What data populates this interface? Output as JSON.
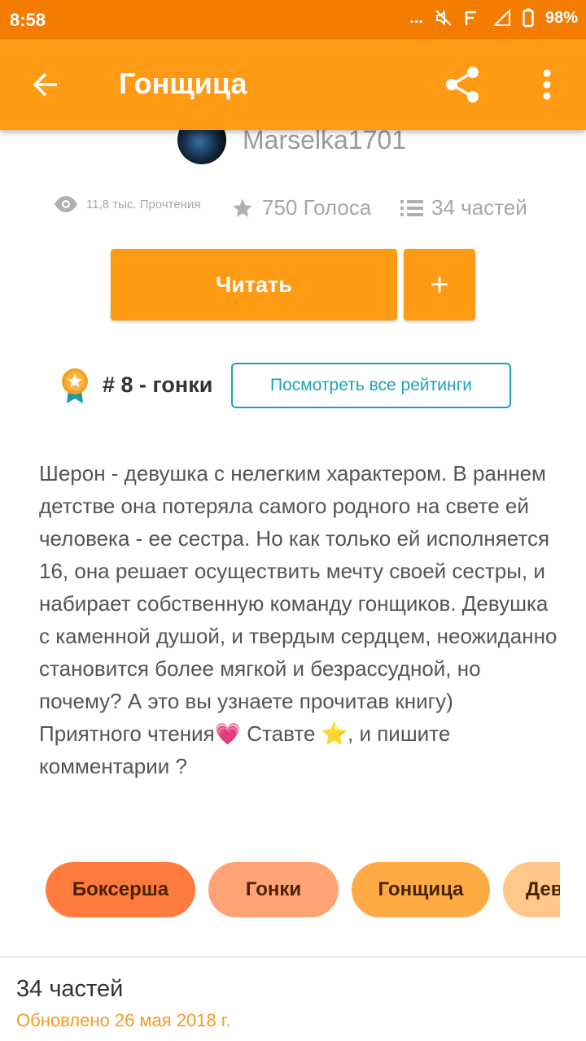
{
  "status_bar": {
    "time": "8:58",
    "dots": "...",
    "battery": "98%"
  },
  "app_bar": {
    "title": "Гонщица"
  },
  "author": {
    "name": "Marselka1701"
  },
  "stats": {
    "reads": "11,8 тыс. Прочтения",
    "votes": "750 Голоса",
    "parts": "34 частей"
  },
  "actions": {
    "read_label": "Читать",
    "add_label": "+"
  },
  "ranking": {
    "text": "# 8 - гонки",
    "view_all_label": "Посмотреть все рейтинги"
  },
  "description": "Шерон - девушка с нелегким характером. В раннем детстве она потеряла самого родного на свете ей человека - ее сестра. Но как только ей исполняется 16, она решает осуществить мечту своей сестры, и набирает собственную команду гонщиков. Девушка с каменной душой, и твердым сердцем, неожиданно становится более мягкой и безрассудной, но почему? А это вы узнаете прочитав книгу)\nПриятного чтения💗  Ставте ⭐, и пишите комментарии ?",
  "tags": [
    {
      "label": "Боксерша",
      "color": "#ff7a3d"
    },
    {
      "label": "Гонки",
      "color": "#ffa374"
    },
    {
      "label": "Гонщица",
      "color": "#ffab45"
    },
    {
      "label": "Дев",
      "color": "#ffc88a"
    }
  ],
  "footer": {
    "parts": "34 частей",
    "updated": "Обновлено 26 мая 2018 г."
  },
  "colors": {
    "status_bar": "#f47c00",
    "app_bar": "#ff9a14",
    "accent_teal": "#1ca3b5",
    "updated_text": "#f59a23"
  },
  "icons": [
    "back-arrow-icon",
    "share-icon",
    "more-vert-icon",
    "eye-icon",
    "star-icon",
    "list-icon",
    "medal-icon",
    "mute-icon",
    "signal-icon",
    "battery-icon"
  ]
}
